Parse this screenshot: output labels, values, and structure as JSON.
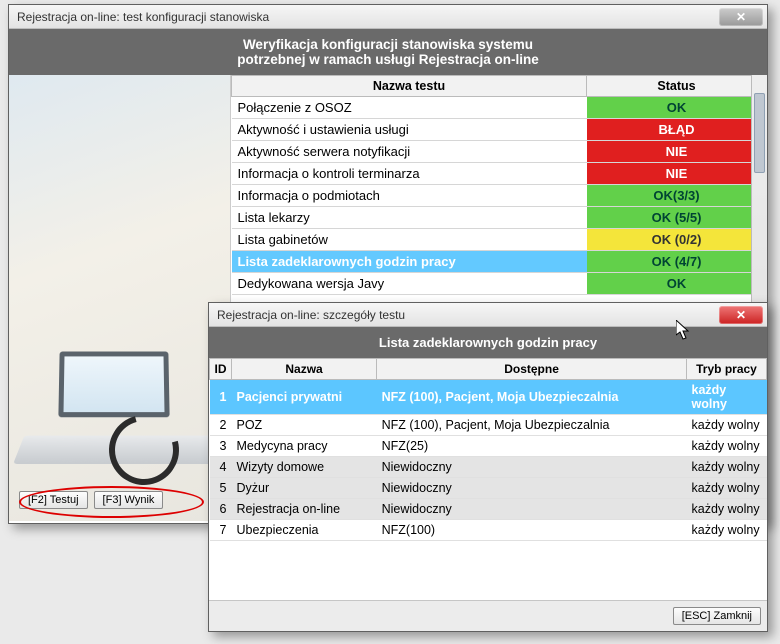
{
  "main": {
    "title": "Rejestracja on-line: test konfiguracji stanowiska",
    "banner_line1": "Weryfikacja konfiguracji stanowiska systemu",
    "banner_line2": "potrzebnej w ramach usługi Rejestracja on-line",
    "columns": {
      "name": "Nazwa testu",
      "status": "Status"
    },
    "rows": [
      {
        "name": "Połączenie z OSOZ",
        "status": "OK",
        "cls": "st-ok"
      },
      {
        "name": "Aktywność i ustawienia usługi",
        "status": "BŁĄD",
        "cls": "st-err"
      },
      {
        "name": "Aktywność serwera notyfikacji",
        "status": "NIE",
        "cls": "st-no"
      },
      {
        "name": "Informacja o kontroli terminarza",
        "status": "NIE",
        "cls": "st-no"
      },
      {
        "name": "Informacja o podmiotach",
        "status": "OK(3/3)",
        "cls": "st-ok"
      },
      {
        "name": "Lista lekarzy",
        "status": "OK (5/5)",
        "cls": "st-ok"
      },
      {
        "name": "Lista gabinetów",
        "status": "OK (0/2)",
        "cls": "st-warn"
      },
      {
        "name": "Lista zadeklarownych godzin pracy",
        "status": "OK (4/7)",
        "cls": "st-ok",
        "selected": true
      },
      {
        "name": "Dedykowana wersja Javy",
        "status": "OK",
        "cls": "st-ok"
      }
    ],
    "btn_test": "[F2] Testuj",
    "btn_result": "[F3] Wynik"
  },
  "detail": {
    "title": "Rejestracja on-line: szczegóły testu",
    "banner": "Lista zadeklarownych godzin pracy",
    "columns": {
      "id": "ID",
      "name": "Nazwa",
      "avail": "Dostępne",
      "mode": "Tryb pracy"
    },
    "rows": [
      {
        "id": "1",
        "name": "Pacjenci prywatni",
        "avail": "NFZ (100), Pacjent, Moja Ubezpieczalnia",
        "mode": "każdy wolny",
        "sel": true
      },
      {
        "id": "2",
        "name": "POZ",
        "avail": "NFZ (100), Pacjent, Moja Ubezpieczalnia",
        "mode": "każdy wolny"
      },
      {
        "id": "3",
        "name": "Medycyna pracy",
        "avail": "NFZ(25)",
        "mode": "każdy wolny"
      },
      {
        "id": "4",
        "name": "Wizyty domowe",
        "avail": "Niewidoczny",
        "mode": "każdy wolny",
        "alt": true
      },
      {
        "id": "5",
        "name": "Dyżur",
        "avail": "Niewidoczny",
        "mode": "każdy wolny",
        "alt": true
      },
      {
        "id": "6",
        "name": "Rejestracja on-line",
        "avail": "Niewidoczny",
        "mode": "każdy wolny",
        "alt": true
      },
      {
        "id": "7",
        "name": "Ubezpieczenia",
        "avail": "NFZ(100)",
        "mode": "każdy wolny"
      }
    ],
    "btn_close": "[ESC] Zamknij"
  }
}
